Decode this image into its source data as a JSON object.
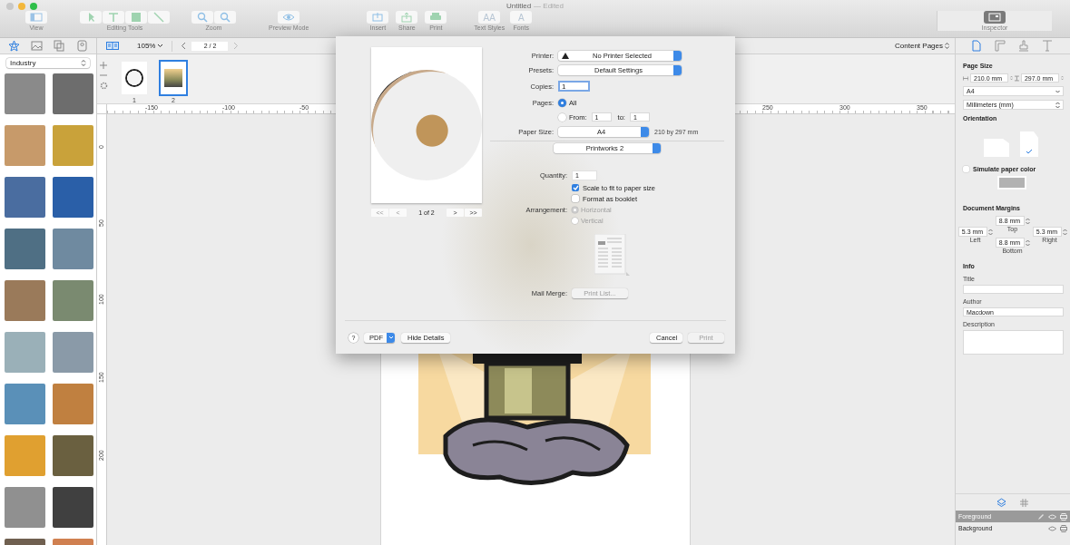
{
  "window": {
    "title": "Untitled",
    "status": "— Edited"
  },
  "toolbar": {
    "groups": [
      {
        "label": "View",
        "buttons": [
          {
            "kind": "view"
          }
        ]
      },
      {
        "label": "Editing Tools",
        "buttons": [
          {
            "kind": "select"
          },
          {
            "kind": "text"
          },
          {
            "kind": "shape"
          },
          {
            "kind": "line"
          }
        ]
      },
      {
        "label": "Zoom",
        "buttons": [
          {
            "kind": "zoom-in"
          },
          {
            "kind": "zoom-out"
          }
        ]
      },
      {
        "label": "Preview Mode",
        "buttons": [
          {
            "kind": "preview"
          }
        ]
      },
      {
        "label": "Insert",
        "buttons": [
          {
            "kind": "insert"
          }
        ]
      },
      {
        "label": "Share",
        "buttons": [
          {
            "kind": "share"
          }
        ]
      },
      {
        "label": "Print",
        "buttons": [
          {
            "kind": "print"
          }
        ]
      },
      {
        "label": "Text Styles",
        "buttons": [
          {
            "kind": "glyph",
            "glyph": "AA"
          }
        ]
      },
      {
        "label": "Fonts",
        "buttons": [
          {
            "kind": "glyph",
            "glyph": "A"
          }
        ]
      }
    ],
    "inspector": {
      "label": "Inspector",
      "selected": true
    }
  },
  "library": {
    "tabs": [
      {
        "kind": "clipart",
        "selected": true
      },
      {
        "kind": "image",
        "selected": false
      },
      {
        "kind": "pages",
        "selected": false
      },
      {
        "kind": "contacts",
        "selected": false
      }
    ],
    "category": "Industry"
  },
  "document_bar": {
    "zoom": "105%",
    "page": "2 / 2",
    "content_pages": "Content Pages"
  },
  "pages": [
    {
      "label": "1",
      "selected": false
    },
    {
      "label": "2",
      "selected": true
    }
  ],
  "ruler": {
    "horizontal": [
      "-150",
      "-100",
      "-50",
      "250",
      "300",
      "350"
    ],
    "vertical": [
      "0",
      "50",
      "100",
      "150",
      "200"
    ]
  },
  "print_dialog": {
    "preview_page": "1 of 2",
    "preview_nav": [
      "<<",
      "<",
      ">",
      ">>"
    ],
    "printer_label": "Printer:",
    "printer": "No Printer Selected",
    "presets_label": "Presets:",
    "presets": "Default Settings",
    "copies_label": "Copies:",
    "copies": "1",
    "pages_label": "Pages:",
    "page_options": [
      {
        "label": "All",
        "selected": true
      },
      {
        "label": "From:",
        "selected": false
      }
    ],
    "from": "1",
    "to_label": "to:",
    "to": "1",
    "paper_size_label": "Paper Size:",
    "paper_size": "A4",
    "paper_dimensions": "210 by 297 mm",
    "section": "Printworks 2",
    "quantity_label": "Quantity:",
    "quantity": "1",
    "options": [
      {
        "label": "Scale to fit to paper size",
        "checked": true
      },
      {
        "label": "Format as booklet",
        "checked": false
      }
    ],
    "arrangement_label": "Arrangement:",
    "arrangement": [
      {
        "label": "Horizontal",
        "selected": true,
        "disabled": true
      },
      {
        "label": "Vertical",
        "selected": false,
        "disabled": true
      }
    ],
    "mail_merge_label": "Mail Merge:",
    "print_list": {
      "label": "Print List...",
      "disabled": true
    },
    "help": "?",
    "pdf": "PDF",
    "hide_details": "Hide Details",
    "cancel": "Cancel",
    "print": {
      "label": "Print",
      "disabled": true
    }
  },
  "inspector": {
    "tabs": [
      {
        "kind": "document",
        "selected": true
      },
      {
        "kind": "layout",
        "selected": false
      },
      {
        "kind": "style",
        "selected": false
      },
      {
        "kind": "text",
        "selected": false
      }
    ],
    "page_size_heading": "Page Size",
    "width": "210.0 mm",
    "height": "297.0 mm",
    "paper": "A4",
    "units": "Millimeters (mm)",
    "orientation_heading": "Orientation",
    "orientations": [
      {
        "kind": "landscape",
        "selected": false
      },
      {
        "kind": "portrait",
        "selected": true
      }
    ],
    "simulate_paper_color": {
      "label": "Simulate paper color",
      "checked": false
    },
    "margins_heading": "Document Margins",
    "margins": {
      "top": {
        "label": "Top",
        "value": "8.8 mm"
      },
      "left": {
        "label": "Left",
        "value": "5.3 mm"
      },
      "right": {
        "label": "Right",
        "value": "5.3 mm"
      },
      "bottom": {
        "label": "Bottom",
        "value": "8.8 mm"
      }
    },
    "info_heading": "Info",
    "fields": [
      {
        "label": "Title",
        "kind": "line"
      },
      {
        "label": "Author",
        "kind": "line",
        "value": "Macdown"
      },
      {
        "label": "Description",
        "kind": "area"
      }
    ],
    "layer_tabs": [
      {
        "kind": "layers",
        "selected": true
      },
      {
        "kind": "grid",
        "selected": false
      }
    ],
    "layers": [
      {
        "name": "Foreground",
        "selected": true
      },
      {
        "name": "Background",
        "selected": false
      }
    ]
  }
}
